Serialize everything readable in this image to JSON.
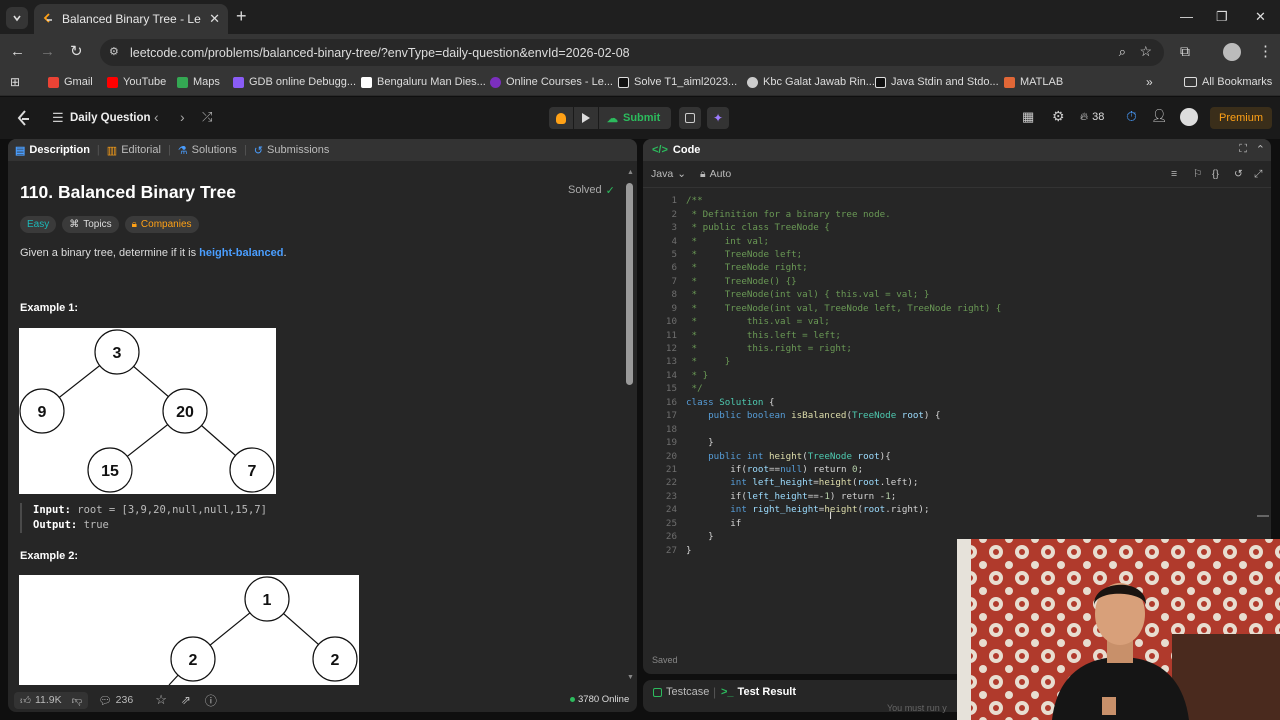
{
  "browser": {
    "tab_title": "Balanced Binary Tree - LeetCode",
    "url": "leetcode.com/problems/balanced-binary-tree/?envType=daily-question&envId=2026-02-08",
    "bookmarks": [
      "Gmail",
      "YouTube",
      "Maps",
      "GDB online Debugg...",
      "Bengaluru Man Dies...",
      "Online Courses - Le...",
      "Solve T1_aiml2023...",
      "Kbc Galat Jawab Rin...",
      "Java Stdin and Stdo...",
      "MATLAB"
    ],
    "all_bookmarks": "All Bookmarks"
  },
  "header": {
    "daily": "Daily Question",
    "submit": "Submit",
    "streak": "38",
    "premium": "Premium"
  },
  "left": {
    "tabs": [
      "Description",
      "Editorial",
      "Solutions",
      "Submissions"
    ],
    "title": "110. Balanced Binary Tree",
    "solved": "Solved",
    "tags": [
      "Easy",
      "Topics",
      "Companies"
    ],
    "desc_pre": "Given a binary tree, determine if it is ",
    "desc_link": "height-balanced",
    "desc_post": ".",
    "ex1": "Example 1:",
    "ex1_input_label": "Input:",
    "ex1_input": "root = [3,9,20,null,null,15,7]",
    "ex1_output_label": "Output:",
    "ex1_output": "true",
    "ex2": "Example 2:",
    "tree1": [
      "3",
      "9",
      "20",
      "15",
      "7"
    ],
    "tree2": [
      "1",
      "2",
      "2"
    ],
    "likes": "11.9K",
    "comments": "236",
    "online": "3780 Online"
  },
  "right": {
    "title": "Code",
    "lang": "Java",
    "auto": "Auto",
    "saved": "Saved",
    "testcase": "Testcase",
    "testresult": "Test Result",
    "overlay_text": "You must run y"
  },
  "code_lines": [
    [
      [
        "/**",
        "cm"
      ]
    ],
    [
      [
        " * Definition for a binary tree node.",
        "cm"
      ]
    ],
    [
      [
        " * public class TreeNode {",
        "cm"
      ]
    ],
    [
      [
        " *     int val;",
        "cm"
      ]
    ],
    [
      [
        " *     TreeNode left;",
        "cm"
      ]
    ],
    [
      [
        " *     TreeNode right;",
        "cm"
      ]
    ],
    [
      [
        " *     TreeNode() {}",
        "cm"
      ]
    ],
    [
      [
        " *     TreeNode(int val) { this.val = val; }",
        "cm"
      ]
    ],
    [
      [
        " *     TreeNode(int val, TreeNode left, TreeNode right) {",
        "cm"
      ]
    ],
    [
      [
        " *         this.val = val;",
        "cm"
      ]
    ],
    [
      [
        " *         this.left = left;",
        "cm"
      ]
    ],
    [
      [
        " *         this.right = right;",
        "cm"
      ]
    ],
    [
      [
        " *     }",
        "cm"
      ]
    ],
    [
      [
        " * }",
        "cm"
      ]
    ],
    [
      [
        " */",
        "cm"
      ]
    ],
    [
      [
        "class ",
        "kw"
      ],
      [
        "Solution",
        "ty"
      ],
      [
        " {",
        "pl"
      ]
    ],
    [
      [
        "    public boolean ",
        "kw"
      ],
      [
        "isBalanced",
        "fn"
      ],
      [
        "(",
        "pl"
      ],
      [
        "TreeNode ",
        "ty"
      ],
      [
        "root",
        "vr"
      ],
      [
        ") {",
        "pl"
      ]
    ],
    [
      [
        "",
        "pl"
      ]
    ],
    [
      [
        "    }",
        "pl"
      ]
    ],
    [
      [
        "    public int ",
        "kw"
      ],
      [
        "height",
        "fn"
      ],
      [
        "(",
        "pl"
      ],
      [
        "TreeNode ",
        "ty"
      ],
      [
        "root",
        "vr"
      ],
      [
        "){",
        "pl"
      ]
    ],
    [
      [
        "        if(",
        "pl"
      ],
      [
        "root",
        "vr"
      ],
      [
        "==",
        "pl"
      ],
      [
        "null",
        "kw"
      ],
      [
        ") return ",
        "pl"
      ],
      [
        "0",
        "nu"
      ],
      [
        ";",
        "pl"
      ]
    ],
    [
      [
        "        int ",
        "kw"
      ],
      [
        "left_height",
        "vr"
      ],
      [
        "=",
        "pl"
      ],
      [
        "height",
        "fn"
      ],
      [
        "(",
        "pl"
      ],
      [
        "root",
        "vr"
      ],
      [
        ".left);",
        "pl"
      ]
    ],
    [
      [
        "        if(",
        "pl"
      ],
      [
        "left_height",
        "vr"
      ],
      [
        "==-",
        "pl"
      ],
      [
        "1",
        "nu"
      ],
      [
        ") return -",
        "pl"
      ],
      [
        "1",
        "nu"
      ],
      [
        ";",
        "pl"
      ]
    ],
    [
      [
        "        int ",
        "kw"
      ],
      [
        "right_height",
        "vr"
      ],
      [
        "=",
        "pl"
      ],
      [
        "height",
        "fn"
      ],
      [
        "(",
        "pl"
      ],
      [
        "root",
        "vr"
      ],
      [
        ".right);",
        "pl"
      ]
    ],
    [
      [
        "        if",
        "pl"
      ]
    ],
    [
      [
        "    }",
        "pl"
      ]
    ],
    [
      [
        "}",
        "pl"
      ]
    ]
  ]
}
